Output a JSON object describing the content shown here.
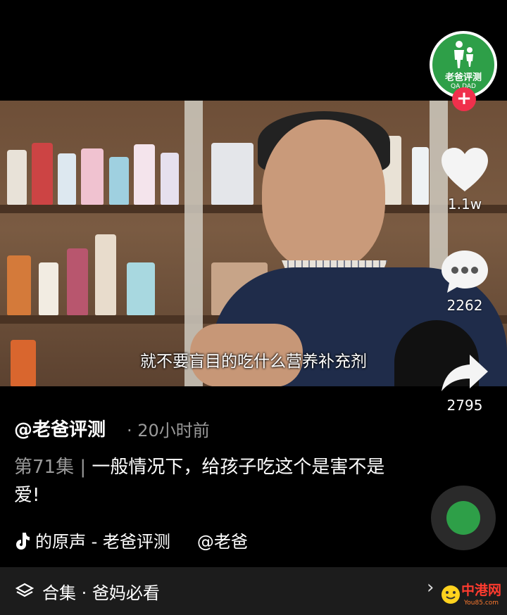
{
  "video": {
    "subtitle": "就不要盲目的吃什么营养补充剂"
  },
  "account": {
    "avatar_text": "老爸评测",
    "avatar_sub": "QA  DAD"
  },
  "actions": {
    "likes": "1.1w",
    "comments": "2262",
    "shares": "2795"
  },
  "post": {
    "author": "@老爸评测",
    "time": "· 20小时前",
    "episode": "第71集 |",
    "text": "一般情况下，给孩子吃这个是害不是爱!"
  },
  "music": {
    "text": "的原声 - 老爸评测",
    "mention": "@老爸"
  },
  "collection": {
    "label": "合集 · 爸妈必看"
  },
  "watermark": {
    "text": "中港网",
    "small": "You85.com"
  },
  "colors": {
    "accent_red": "#f0304c",
    "brand_green": "#2e9f48"
  }
}
